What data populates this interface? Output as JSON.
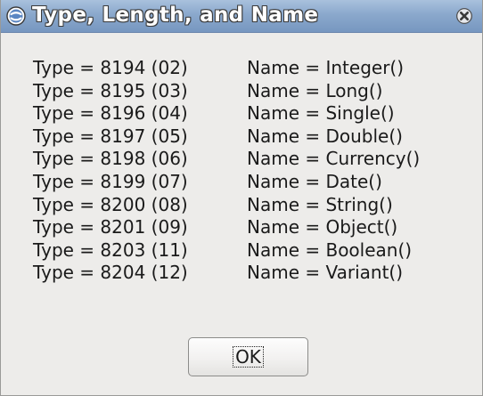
{
  "window": {
    "title": "Type, Length, and Name",
    "icon": "app-icon",
    "close_icon": "close-icon"
  },
  "lines": [
    {
      "type": "Type = 8194 (02)",
      "name": "Name = Integer()"
    },
    {
      "type": "Type = 8195 (03)",
      "name": "Name = Long()"
    },
    {
      "type": "Type = 8196 (04)",
      "name": "Name = Single()"
    },
    {
      "type": "Type = 8197 (05)",
      "name": "Name = Double()"
    },
    {
      "type": "Type = 8198 (06)",
      "name": "Name = Currency()"
    },
    {
      "type": "Type = 8199 (07)",
      "name": "Name = Date()"
    },
    {
      "type": "Type = 8200 (08)",
      "name": "Name = String()"
    },
    {
      "type": "Type = 8201 (09)",
      "name": "Name = Object()"
    },
    {
      "type": "Type = 8203 (11)",
      "name": "Name = Boolean()"
    },
    {
      "type": "Type = 8204 (12)",
      "name": "Name = Variant()"
    }
  ],
  "buttons": {
    "ok_label": "OK"
  },
  "colors": {
    "titlebar": "#8aa8cc",
    "dialog_background": "#edecea",
    "text": "#1a1a1a"
  }
}
